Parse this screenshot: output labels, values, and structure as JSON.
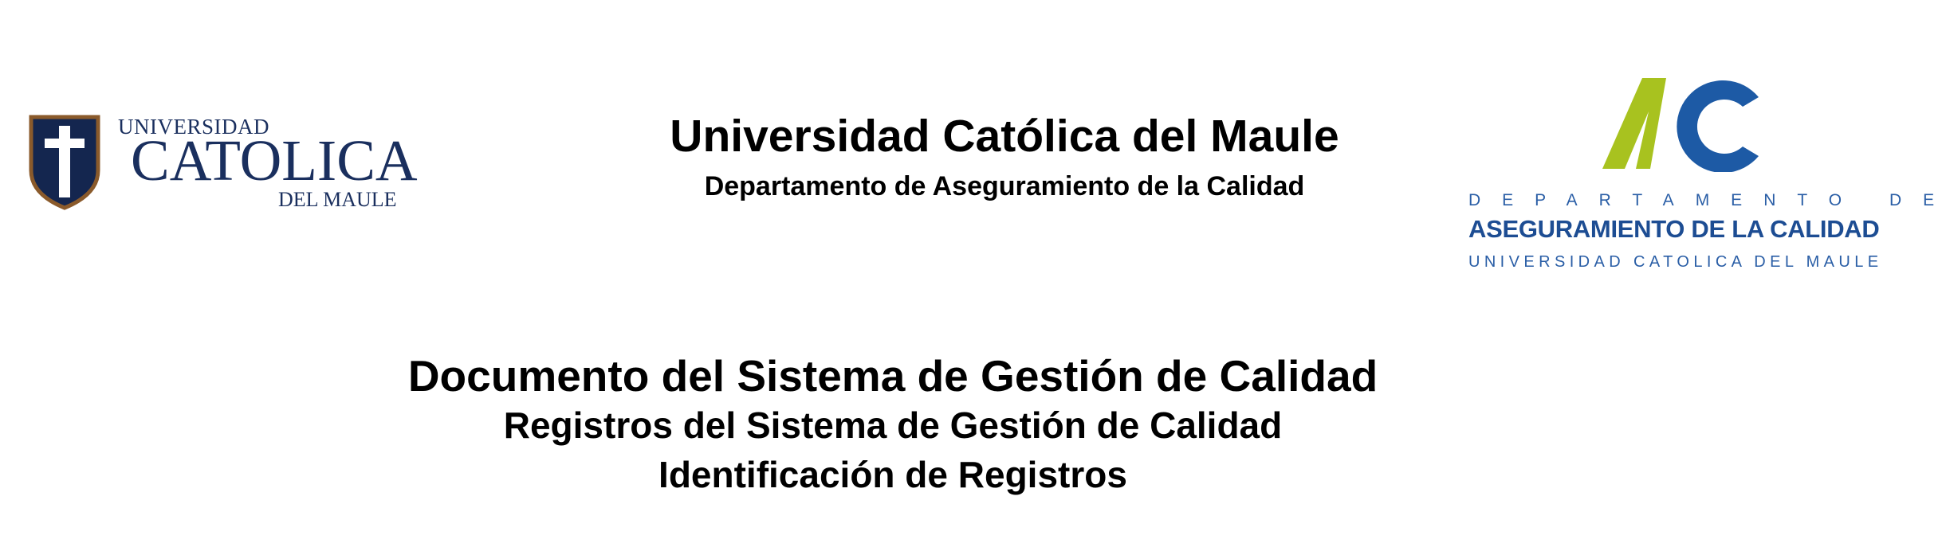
{
  "header": {
    "title": "Universidad Católica del Maule",
    "subtitle": "Departamento de Aseguramiento de la Calidad"
  },
  "left_logo": {
    "line_top": "UNIVERSIDAD",
    "line_main": "CATOLICA",
    "line_bottom": "DEL MAULE",
    "colors": {
      "shield": "#14264f",
      "cross": "#ffffff",
      "border": "#8a5a2b",
      "text": "#1a2f5e"
    }
  },
  "right_logo": {
    "line1": "DEPARTAMENTO DE",
    "line2": "ASEGURAMIENTO DE LA CALIDAD",
    "line3": "UNIVERSIDAD CATOLICA DEL MAULE",
    "colors": {
      "green": "#a8c21f",
      "blue": "#1d5aa5"
    }
  },
  "document": {
    "title": "Documento del Sistema de Gestión de Calidad",
    "subtitle": "Registros del Sistema de Gestión de Calidad",
    "subsubtitle": "Identificación de Registros"
  }
}
